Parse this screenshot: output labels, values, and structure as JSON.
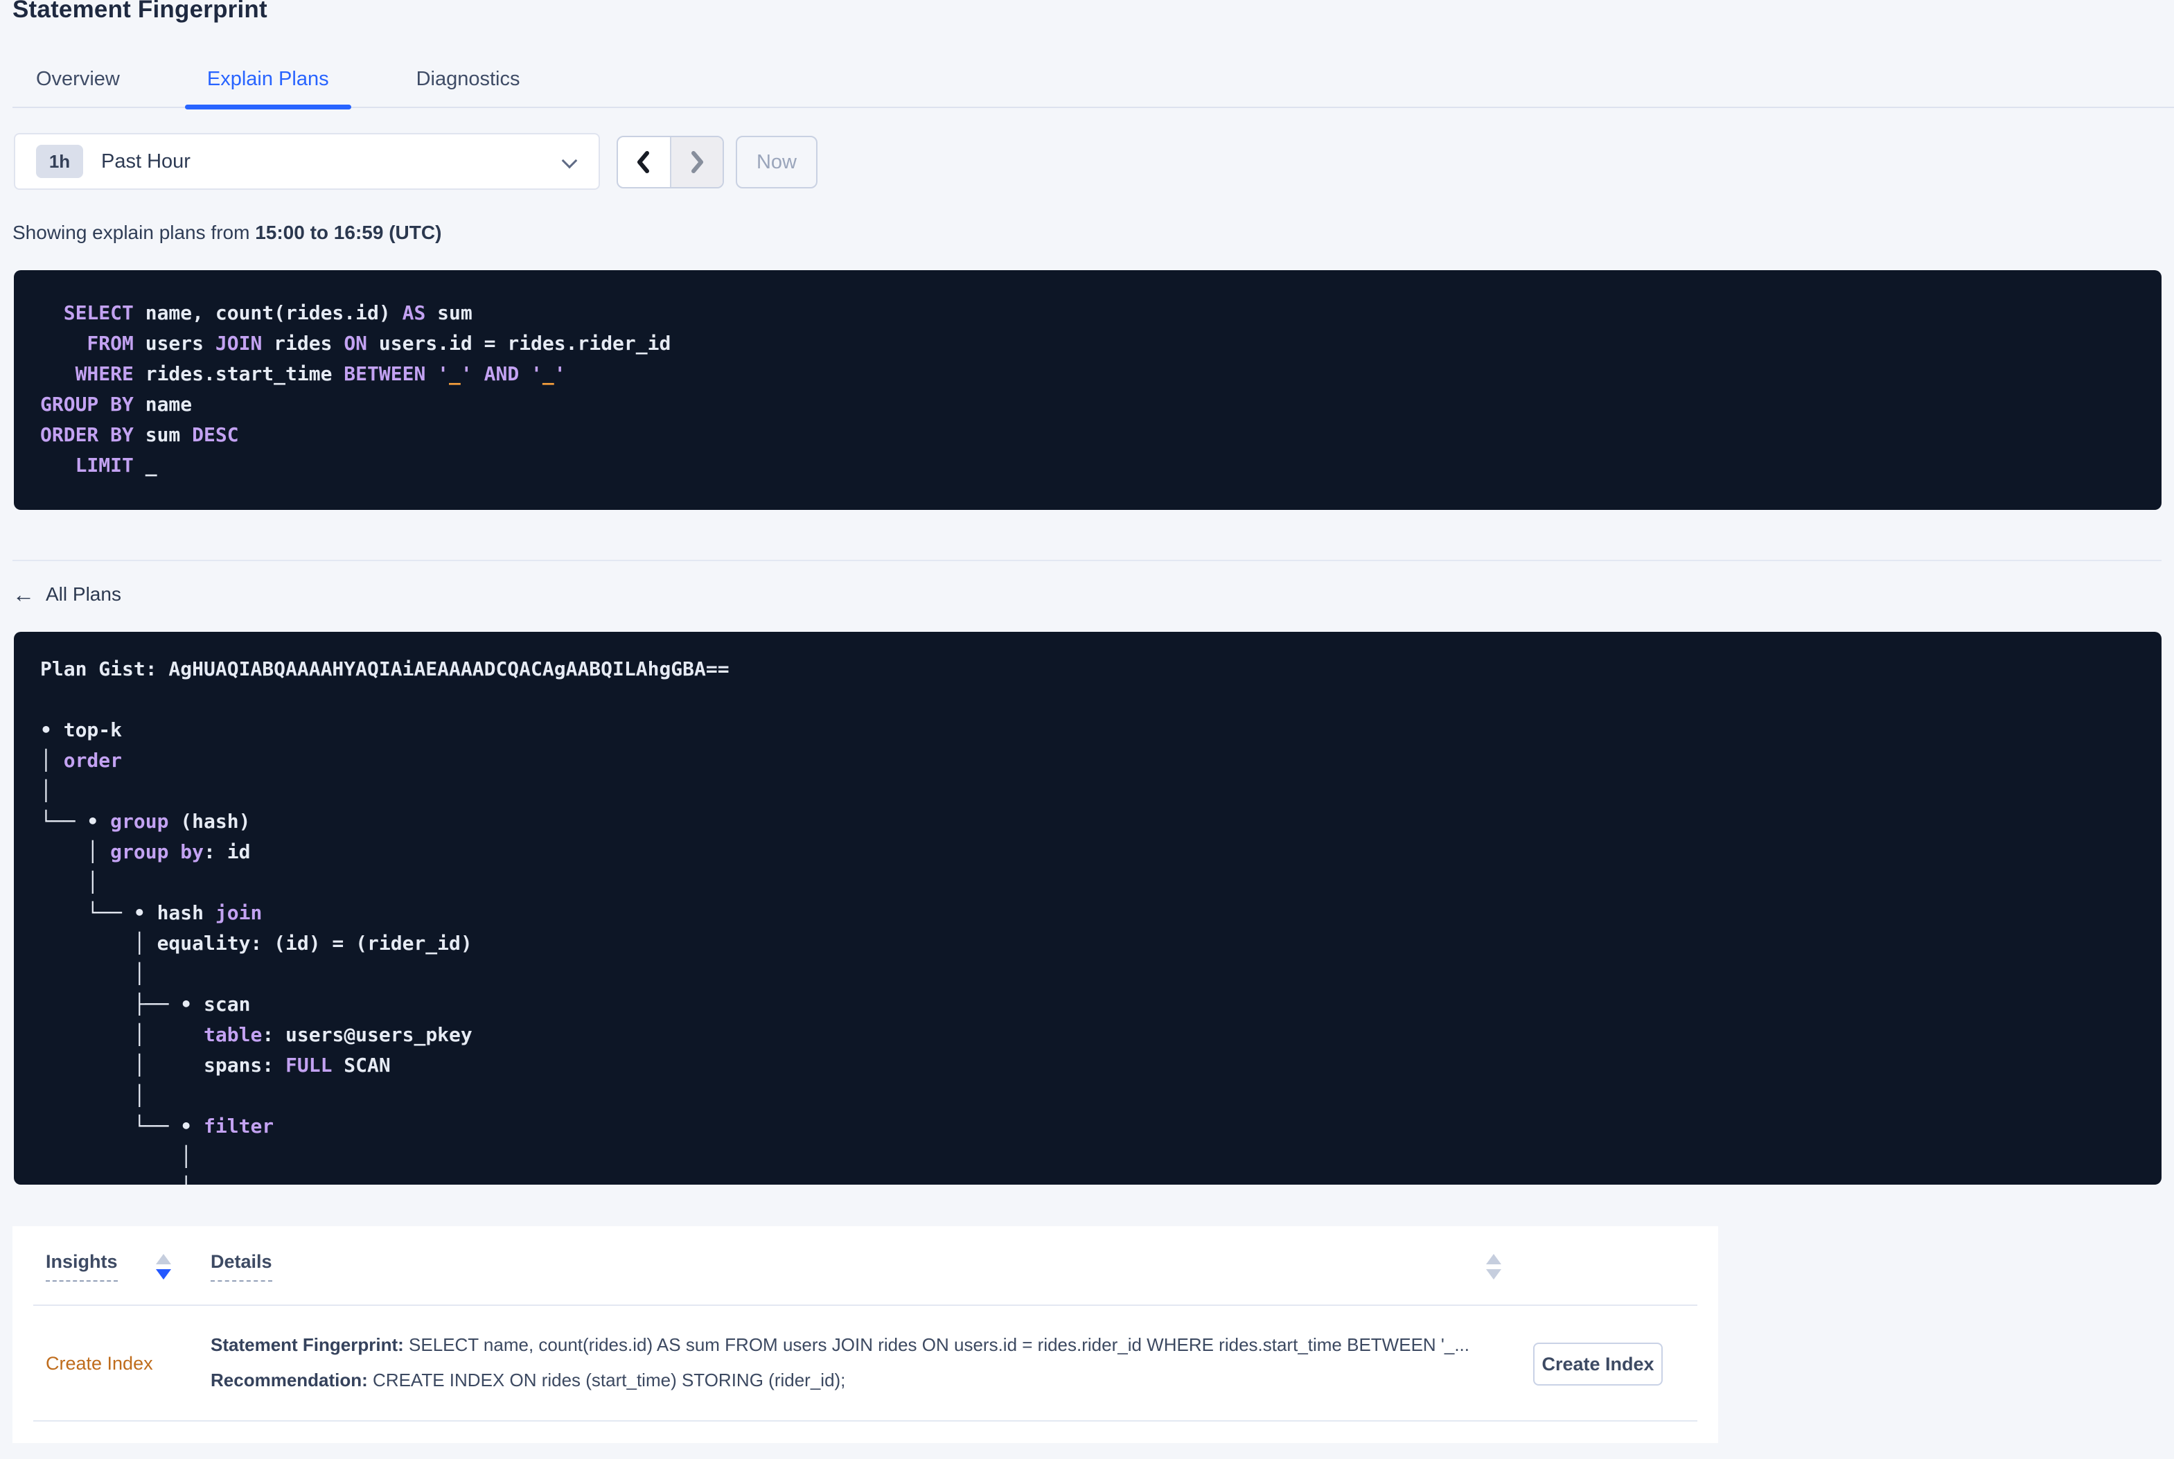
{
  "page": {
    "title": "Statement Fingerprint"
  },
  "tabs": [
    {
      "label": "Overview",
      "active": false
    },
    {
      "label": "Explain Plans",
      "active": true
    },
    {
      "label": "Diagnostics",
      "active": false
    }
  ],
  "time_selector": {
    "badge": "1h",
    "label": "Past Hour",
    "now_label": "Now"
  },
  "showing": {
    "prefix": "Showing explain plans from ",
    "range": "15:00 to 16:59 (UTC)"
  },
  "sql": {
    "lines": [
      [
        {
          "c": "p",
          "t": "  SELECT"
        },
        {
          "c": "w",
          "t": " name, count(rides.id) "
        },
        {
          "c": "p",
          "t": "AS"
        },
        {
          "c": "w",
          "t": " sum"
        }
      ],
      [
        {
          "c": "p",
          "t": "    FROM"
        },
        {
          "c": "w",
          "t": " users "
        },
        {
          "c": "p",
          "t": "JOIN"
        },
        {
          "c": "w",
          "t": " rides "
        },
        {
          "c": "p",
          "t": "ON"
        },
        {
          "c": "w",
          "t": " users.id = rides.rider_id"
        }
      ],
      [
        {
          "c": "p",
          "t": "   WHERE"
        },
        {
          "c": "w",
          "t": " rides.start_time "
        },
        {
          "c": "p",
          "t": "BETWEEN"
        },
        {
          "c": "w",
          "t": " "
        },
        {
          "c": "p",
          "t": "'"
        },
        {
          "c": "o",
          "t": "_"
        },
        {
          "c": "p",
          "t": "'"
        },
        {
          "c": "w",
          "t": " "
        },
        {
          "c": "p",
          "t": "AND"
        },
        {
          "c": "w",
          "t": " "
        },
        {
          "c": "p",
          "t": "'"
        },
        {
          "c": "o",
          "t": "_"
        },
        {
          "c": "p",
          "t": "'"
        }
      ],
      [
        {
          "c": "p",
          "t": "GROUP BY"
        },
        {
          "c": "w",
          "t": " name"
        }
      ],
      [
        {
          "c": "p",
          "t": "ORDER BY"
        },
        {
          "c": "w",
          "t": " sum "
        },
        {
          "c": "p",
          "t": "DESC"
        }
      ],
      [
        {
          "c": "p",
          "t": "   LIMIT"
        },
        {
          "c": "w",
          "t": " _"
        }
      ]
    ]
  },
  "all_plans_label": "All Plans",
  "plan": {
    "lines": [
      [
        {
          "c": "w",
          "t": "Plan Gist: AgHUAQIABQAAAAHYAQIAiAEAAAADCQACAgAABQILAhgGBA=="
        }
      ],
      [
        {
          "c": "w",
          "t": ""
        }
      ],
      [
        {
          "c": "w",
          "t": "• top-k"
        }
      ],
      [
        {
          "c": "w",
          "t": "│ "
        },
        {
          "c": "p",
          "t": "order"
        }
      ],
      [
        {
          "c": "w",
          "t": "│"
        }
      ],
      [
        {
          "c": "w",
          "t": "└── • "
        },
        {
          "c": "p",
          "t": "group"
        },
        {
          "c": "w",
          "t": " (hash)"
        }
      ],
      [
        {
          "c": "w",
          "t": "    │ "
        },
        {
          "c": "p",
          "t": "group by"
        },
        {
          "c": "w",
          "t": ": id"
        }
      ],
      [
        {
          "c": "w",
          "t": "    │"
        }
      ],
      [
        {
          "c": "w",
          "t": "    └── • hash "
        },
        {
          "c": "p",
          "t": "join"
        }
      ],
      [
        {
          "c": "w",
          "t": "        │ equality: (id) = (rider_id)"
        }
      ],
      [
        {
          "c": "w",
          "t": "        │"
        }
      ],
      [
        {
          "c": "w",
          "t": "        ├── • scan"
        }
      ],
      [
        {
          "c": "w",
          "t": "        │     "
        },
        {
          "c": "p",
          "t": "table"
        },
        {
          "c": "w",
          "t": ": users@users_pkey"
        }
      ],
      [
        {
          "c": "w",
          "t": "        │     spans: "
        },
        {
          "c": "p",
          "t": "FULL"
        },
        {
          "c": "w",
          "t": " SCAN"
        }
      ],
      [
        {
          "c": "w",
          "t": "        │"
        }
      ],
      [
        {
          "c": "w",
          "t": "        └── • "
        },
        {
          "c": "p",
          "t": "filter"
        }
      ],
      [
        {
          "c": "w",
          "t": "            │"
        }
      ],
      [
        {
          "c": "w",
          "t": "            │"
        }
      ]
    ]
  },
  "insights_table": {
    "columns": {
      "insights": "Insights",
      "details": "Details"
    },
    "row": {
      "insight": "Create Index",
      "statement_label": "Statement Fingerprint:",
      "statement": " SELECT name, count(rides.id) AS sum FROM users JOIN rides ON users.id = rides.rider_id WHERE rides.start_time BETWEEN '_...",
      "recommendation_label": "Recommendation:",
      "recommendation": " CREATE INDEX ON rides (start_time) STORING (rider_id);",
      "action_label": "Create Index"
    }
  },
  "colors": {
    "accent_blue": "#2864ff",
    "panel_bg": "#0d1626",
    "keyword_purple": "#c3a2f2",
    "code_white": "#e6ebf4",
    "placeholder_orange": "#ffa43d",
    "insight_orange": "#bf6c1c",
    "page_bg": "#f4f6fa"
  }
}
